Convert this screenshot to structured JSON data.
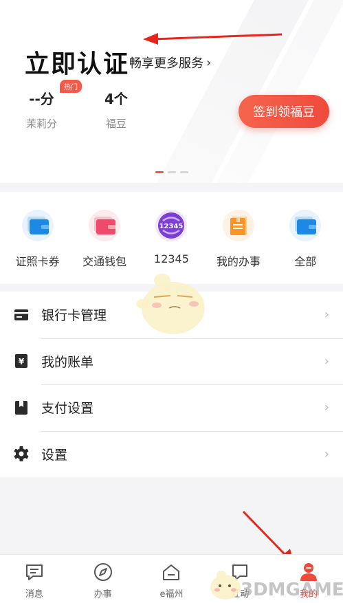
{
  "header": {
    "title": "立即认证",
    "subtitle": "畅享更多服务",
    "subtitle_chevron": "›",
    "stats": [
      {
        "value": "--分",
        "label": "茉莉分"
      },
      {
        "value": "4个",
        "label": "福豆"
      }
    ],
    "hot_badge": "热门",
    "signin_button": "签到领福豆",
    "carousel": {
      "total": 3,
      "active": 0
    }
  },
  "services": [
    {
      "label": "证照卡券",
      "icon": "wallet-blue-icon"
    },
    {
      "label": "交通钱包",
      "icon": "wallet-pink-icon"
    },
    {
      "label": "12345",
      "icon": "hotline-12345-icon",
      "badge_text": "12345"
    },
    {
      "label": "我的办事",
      "icon": "document-orange-icon"
    },
    {
      "label": "全部",
      "icon": "wallet-blue-icon"
    }
  ],
  "menu": [
    {
      "label": "银行卡管理",
      "icon": "bank-card-icon"
    },
    {
      "label": "我的账单",
      "icon": "bill-yen-icon"
    },
    {
      "label": "支付设置",
      "icon": "book-icon"
    },
    {
      "label": "设置",
      "icon": "gear-icon"
    }
  ],
  "menu_chevron": "›",
  "tabbar": [
    {
      "label": "消息",
      "icon": "message-icon",
      "active": false
    },
    {
      "label": "办事",
      "icon": "compass-icon",
      "active": false
    },
    {
      "label": "e福州",
      "icon": "home-icon",
      "active": false
    },
    {
      "label": "互动",
      "icon": "chat-icon",
      "active": false
    },
    {
      "label": "我的",
      "icon": "user-icon",
      "active": true
    }
  ],
  "watermark": "3DMGAME",
  "colors": {
    "accent": "#ef4b3d",
    "text": "#222222",
    "muted": "#8a8a8a",
    "background": "#f4f4f6"
  }
}
